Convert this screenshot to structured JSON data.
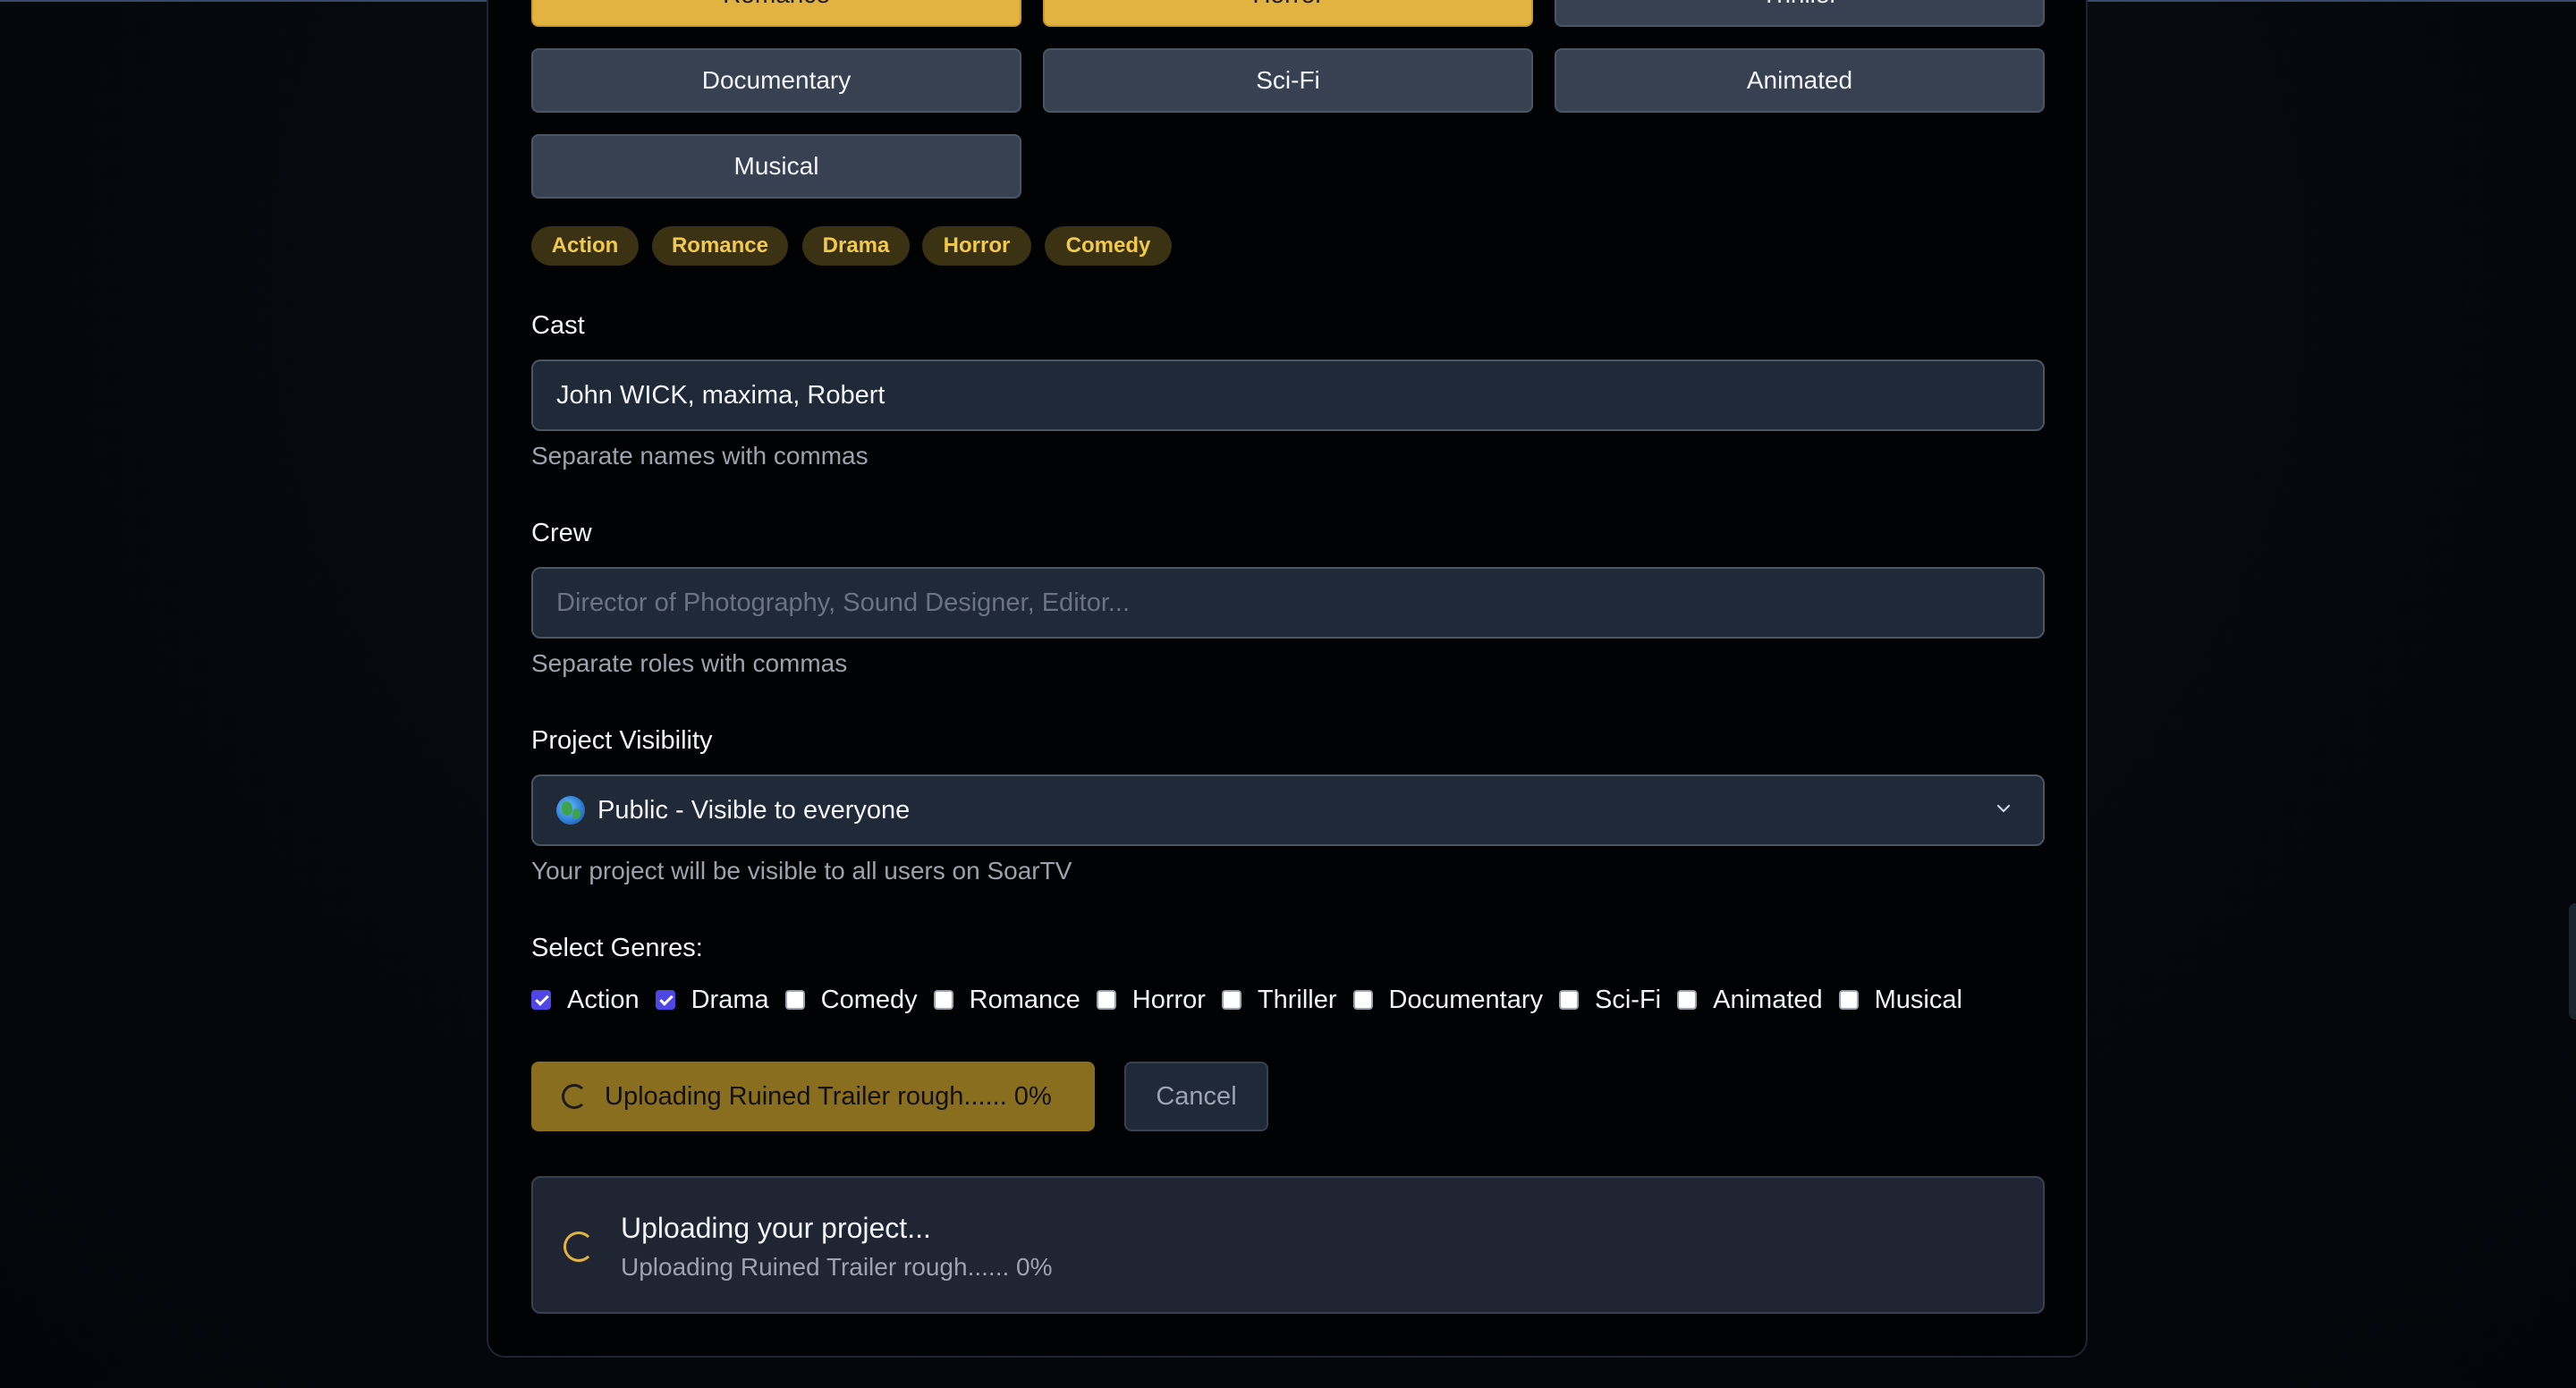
{
  "genre_grid": {
    "row0": [
      "Romance",
      "Horror",
      "Thriller"
    ],
    "row1": [
      "Documentary",
      "Sci-Fi",
      "Animated"
    ],
    "row2": [
      "Musical"
    ]
  },
  "selected_chips": [
    "Action",
    "Romance",
    "Drama",
    "Horror",
    "Comedy"
  ],
  "cast": {
    "label": "Cast",
    "value": "John WICK, maxima, Robert",
    "help": "Separate names with commas"
  },
  "crew": {
    "label": "Crew",
    "value": "",
    "placeholder": "Director of Photography, Sound Designer, Editor...",
    "help": "Separate roles with commas"
  },
  "visibility": {
    "label": "Project Visibility",
    "selected": "Public - Visible to everyone",
    "help": "Your project will be visible to all users on SoarTV"
  },
  "genres_checkbox": {
    "label": "Select Genres:",
    "items": [
      {
        "label": "Action",
        "checked": true
      },
      {
        "label": "Drama",
        "checked": true
      },
      {
        "label": "Comedy",
        "checked": false
      },
      {
        "label": "Romance",
        "checked": false
      },
      {
        "label": "Horror",
        "checked": false
      },
      {
        "label": "Thriller",
        "checked": false
      },
      {
        "label": "Documentary",
        "checked": false
      },
      {
        "label": "Sci-Fi",
        "checked": false
      },
      {
        "label": "Animated",
        "checked": false
      },
      {
        "label": "Musical",
        "checked": false
      }
    ]
  },
  "actions": {
    "upload_label": "Uploading Ruined Trailer rough...... 0%",
    "cancel_label": "Cancel"
  },
  "status": {
    "title": "Uploading your project...",
    "detail": "Uploading Ruined Trailer rough...... 0%"
  },
  "colors": {
    "accent": "#e3b341",
    "accent_dim": "#8a6e1f",
    "checkbox_on": "#4f46e5"
  }
}
